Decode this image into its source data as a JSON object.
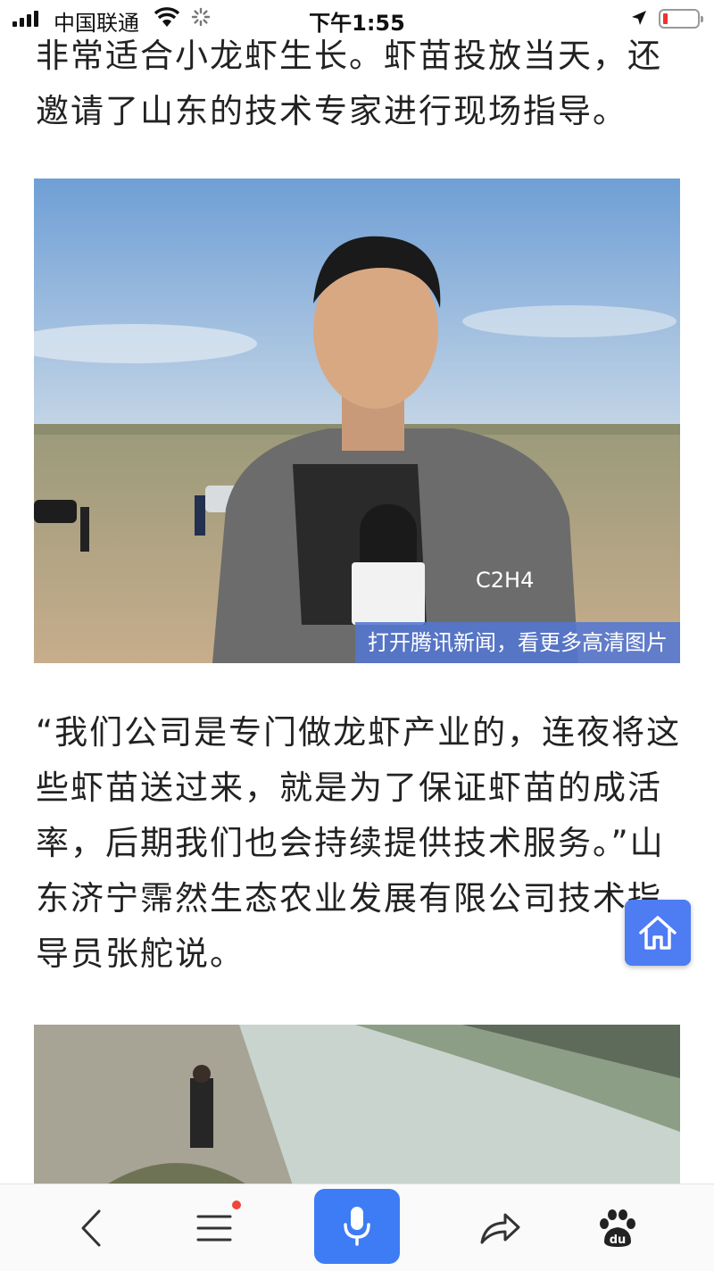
{
  "status_bar": {
    "carrier": "中国联通",
    "time": "下午1:55",
    "icons": [
      "signal-icon",
      "wifi-icon",
      "loading-icon",
      "location-icon",
      "battery-icon"
    ],
    "battery_color": "#e33333"
  },
  "article": {
    "paragraph_1": "非常适合小龙虾生长。虾苗投放当天，还邀请了山东的技术专家进行现场指导。",
    "photo_1_caption": "打开腾讯新闻，看更多高清图片",
    "microphone_logo_text": "C2H4",
    "paragraph_2": "“我们公司是专门做龙虾产业的，连夜将这些虾苗送过来，就是为了保证虾苗的成活率，后期我们也会持续提供技术服务。”山东济宁霈然生态农业发展有限公司技术指导员张舵说。"
  },
  "floating": {
    "home_icon": "home-icon",
    "color": "#4e7cf3"
  },
  "toolbar": {
    "items": [
      "back-icon",
      "menu-icon",
      "microphone-icon",
      "share-icon",
      "baidu-paw-icon"
    ],
    "accent": "#3d7cf5",
    "notification_dot_color": "#f0453a"
  }
}
